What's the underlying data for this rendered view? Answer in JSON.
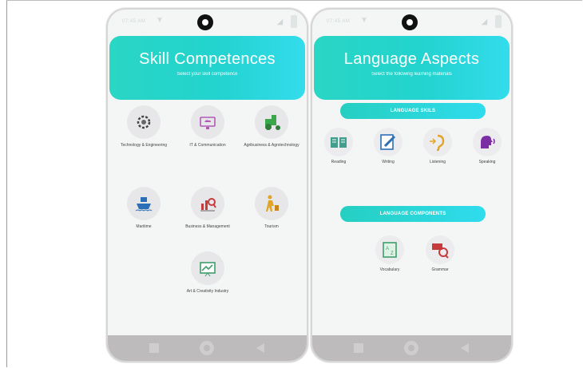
{
  "left_screen": {
    "status_time": "07:45 AM",
    "title": "Skill Competences",
    "subtitle": "Select your skill competence",
    "items": [
      {
        "label": "Technology & Engineering",
        "icon": "gear-circuit-icon"
      },
      {
        "label": "IT & Communication",
        "icon": "monitor-cloud-icon"
      },
      {
        "label": "Agribusiness & Agrotechnology",
        "icon": "tractor-icon"
      },
      {
        "label": "Maritime",
        "icon": "ship-icon"
      },
      {
        "label": "Business & Management",
        "icon": "chart-magnifier-icon"
      },
      {
        "label": "Tourism",
        "icon": "traveler-icon"
      },
      {
        "label": "Art & Creativity Industry",
        "icon": "drawing-board-icon"
      }
    ]
  },
  "right_screen": {
    "status_time": "07:45 AM",
    "title": "Language Aspects",
    "subtitle": "Select the following learning materials",
    "skills_header": "LANGUAGE SKILS",
    "skills": [
      {
        "label": "Reading",
        "icon": "book-icon"
      },
      {
        "label": "Writing",
        "icon": "pencil-note-icon"
      },
      {
        "label": "Listening",
        "icon": "ear-icon"
      },
      {
        "label": "Speaking",
        "icon": "speaking-head-icon"
      }
    ],
    "components_header": "LANGUAGE COMPONENTS",
    "components": [
      {
        "label": "Vocabulary",
        "icon": "dictionary-icon"
      },
      {
        "label": "Grammar",
        "icon": "grammar-check-icon"
      }
    ]
  },
  "colors": {
    "banner_gradient_start": "#2ad6c4",
    "banner_gradient_end": "#34dcec",
    "navbar": "#bdbbbb"
  }
}
